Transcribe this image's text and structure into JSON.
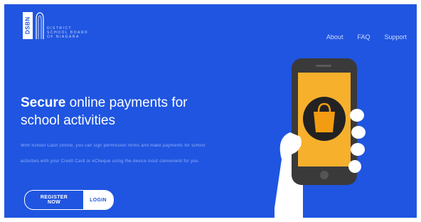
{
  "brand": {
    "logo_text": "DSBN",
    "district_name_lines": [
      "District",
      "School Board",
      "of Niagara"
    ]
  },
  "nav": {
    "items": [
      "About",
      "FAQ",
      "Support"
    ]
  },
  "hero": {
    "headline_strong": "Secure",
    "headline_rest": " online payments for school activities",
    "description": "With School Cash Online, you can sign permission forms and make payments for school activities with your Credit Card or eCheque using the device most convenient for you.",
    "register_label": "REGISTER NOW",
    "login_label": "LOGIN"
  },
  "colors": {
    "hero_background": "#1f55e0",
    "phone_body": "#3a3a3a",
    "phone_screen": "#f6b02c",
    "bag_circle": "#222222",
    "bag_color": "#f39c12",
    "hand": "#ffffff"
  },
  "icons": {
    "logo": "dsbn-logo-icon",
    "phone": "smartphone-icon",
    "bag": "shopping-bag-icon"
  }
}
